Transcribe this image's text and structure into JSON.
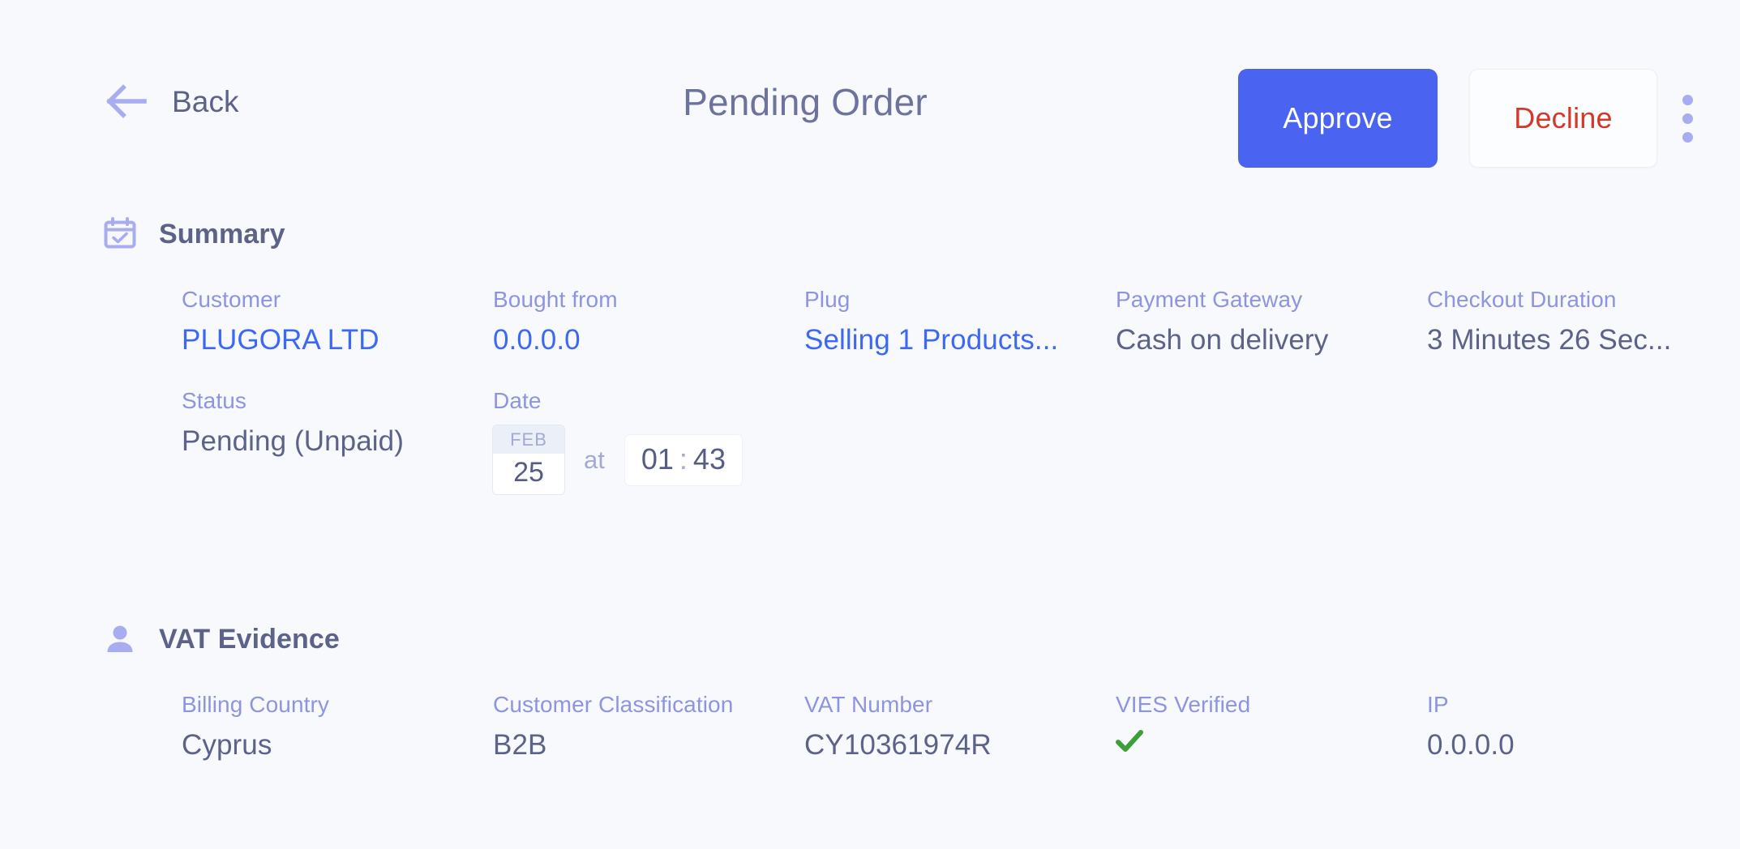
{
  "header": {
    "back_label": "Back",
    "back_icon": "arrow-left-icon",
    "title": "Pending Order",
    "approve_label": "Approve",
    "decline_label": "Decline",
    "more_icon": "more-vertical-icon",
    "approve_color": "#4A63F0",
    "decline_color": "#D2392A"
  },
  "summary": {
    "icon": "calendar-check-icon",
    "title": "Summary",
    "fields": [
      {
        "label": "Customer",
        "value": "PLUGORA LTD",
        "style": "link"
      },
      {
        "label": "Bought from",
        "value": "0.0.0.0",
        "style": "link"
      },
      {
        "label": "Plug",
        "value": "Selling 1 Products...",
        "style": "link"
      },
      {
        "label": "Payment Gateway",
        "value": "Cash on delivery",
        "style": "text"
      },
      {
        "label": "Checkout Duration",
        "value": "3 Minutes 26 Sec...",
        "style": "text"
      }
    ],
    "status": {
      "label": "Status",
      "value": "Pending (Unpaid)"
    },
    "date": {
      "label": "Date",
      "month": "FEB",
      "day": "25",
      "at": "at",
      "hours": "01",
      "separator": ":",
      "minutes": "43"
    }
  },
  "vat_evidence": {
    "icon": "user-icon",
    "title": "VAT Evidence",
    "fields": [
      {
        "label": "Billing Country",
        "value": "Cyprus",
        "style": "text"
      },
      {
        "label": "Customer Classification",
        "value": "B2B",
        "style": "text"
      },
      {
        "label": "VAT Number",
        "value": "CY10361974R",
        "style": "text"
      },
      {
        "label": "VIES Verified",
        "value": "",
        "style": "check",
        "icon": "check-icon",
        "color": "#3E9E3A"
      },
      {
        "label": "IP",
        "value": "0.0.0.0",
        "style": "text"
      }
    ]
  },
  "theme": {
    "background": "#F7F9FC",
    "label_color": "#8E95E0",
    "value_color": "#5C6288",
    "link_color": "#3D68F5",
    "icon_color": "#A7ADF0"
  }
}
